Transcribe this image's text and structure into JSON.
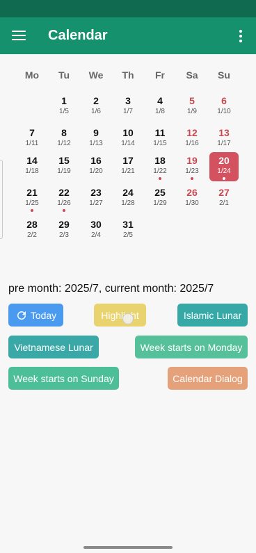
{
  "app_bar": {
    "title": "Calendar"
  },
  "weekdays": [
    "Mo",
    "Tu",
    "We",
    "Th",
    "Fr",
    "Sa",
    "Su"
  ],
  "weeks": [
    [
      null,
      {
        "day": "1",
        "lunar": "1/5"
      },
      {
        "day": "2",
        "lunar": "1/6"
      },
      {
        "day": "3",
        "lunar": "1/7"
      },
      {
        "day": "4",
        "lunar": "1/8"
      },
      {
        "day": "5",
        "lunar": "1/9"
      },
      {
        "day": "6",
        "lunar": "1/10"
      }
    ],
    [
      {
        "day": "7",
        "lunar": "1/11"
      },
      {
        "day": "8",
        "lunar": "1/12"
      },
      {
        "day": "9",
        "lunar": "1/13"
      },
      {
        "day": "10",
        "lunar": "1/14"
      },
      {
        "day": "11",
        "lunar": "1/15"
      },
      {
        "day": "12",
        "lunar": "1/16"
      },
      {
        "day": "13",
        "lunar": "1/17"
      }
    ],
    [
      {
        "day": "14",
        "lunar": "1/18"
      },
      {
        "day": "15",
        "lunar": "1/19"
      },
      {
        "day": "16",
        "lunar": "1/20"
      },
      {
        "day": "17",
        "lunar": "1/21"
      },
      {
        "day": "18",
        "lunar": "1/22",
        "dot": true
      },
      {
        "day": "19",
        "lunar": "1/23",
        "dot": true
      },
      {
        "day": "20",
        "lunar": "1/24",
        "dot": true,
        "selected": true
      }
    ],
    [
      {
        "day": "21",
        "lunar": "1/25",
        "dot": true
      },
      {
        "day": "22",
        "lunar": "1/26",
        "dot": true
      },
      {
        "day": "23",
        "lunar": "1/27"
      },
      {
        "day": "24",
        "lunar": "1/28"
      },
      {
        "day": "25",
        "lunar": "1/29"
      },
      {
        "day": "26",
        "lunar": "1/30"
      },
      {
        "day": "27",
        "lunar": "2/1"
      }
    ],
    [
      {
        "day": "28",
        "lunar": "2/2"
      },
      {
        "day": "29",
        "lunar": "2/3"
      },
      {
        "day": "30",
        "lunar": "2/4"
      },
      {
        "day": "31",
        "lunar": "2/5"
      },
      null,
      null,
      null
    ]
  ],
  "month_info": "pre month: 2025/7, current month: 2025/7",
  "buttons": {
    "today": {
      "label": "Today",
      "icon": "refresh-icon",
      "color": "#4a9bf0"
    },
    "highlight": {
      "label": "Highlight",
      "color": "#e8d36f"
    },
    "islamic_lunar": {
      "label": "Islamic Lunar",
      "color": "#36a9a6"
    },
    "vietnamese_lunar": {
      "label": "Vietnamese Lunar",
      "color": "#3aa8a6"
    },
    "week_monday": {
      "label": "Week starts on Monday",
      "color": "#55c09a"
    },
    "week_sunday": {
      "label": "Week starts on Sunday",
      "color": "#4cbf98"
    },
    "calendar_dialog": {
      "label": "Calendar Dialog",
      "color": "#e5a17a"
    }
  },
  "colors": {
    "status_bar": "#0f6a4f",
    "app_bar": "#15916d",
    "weekend_text": "#c9484f",
    "selected_day": "#d4515f",
    "event_dot": "#d14a50"
  }
}
